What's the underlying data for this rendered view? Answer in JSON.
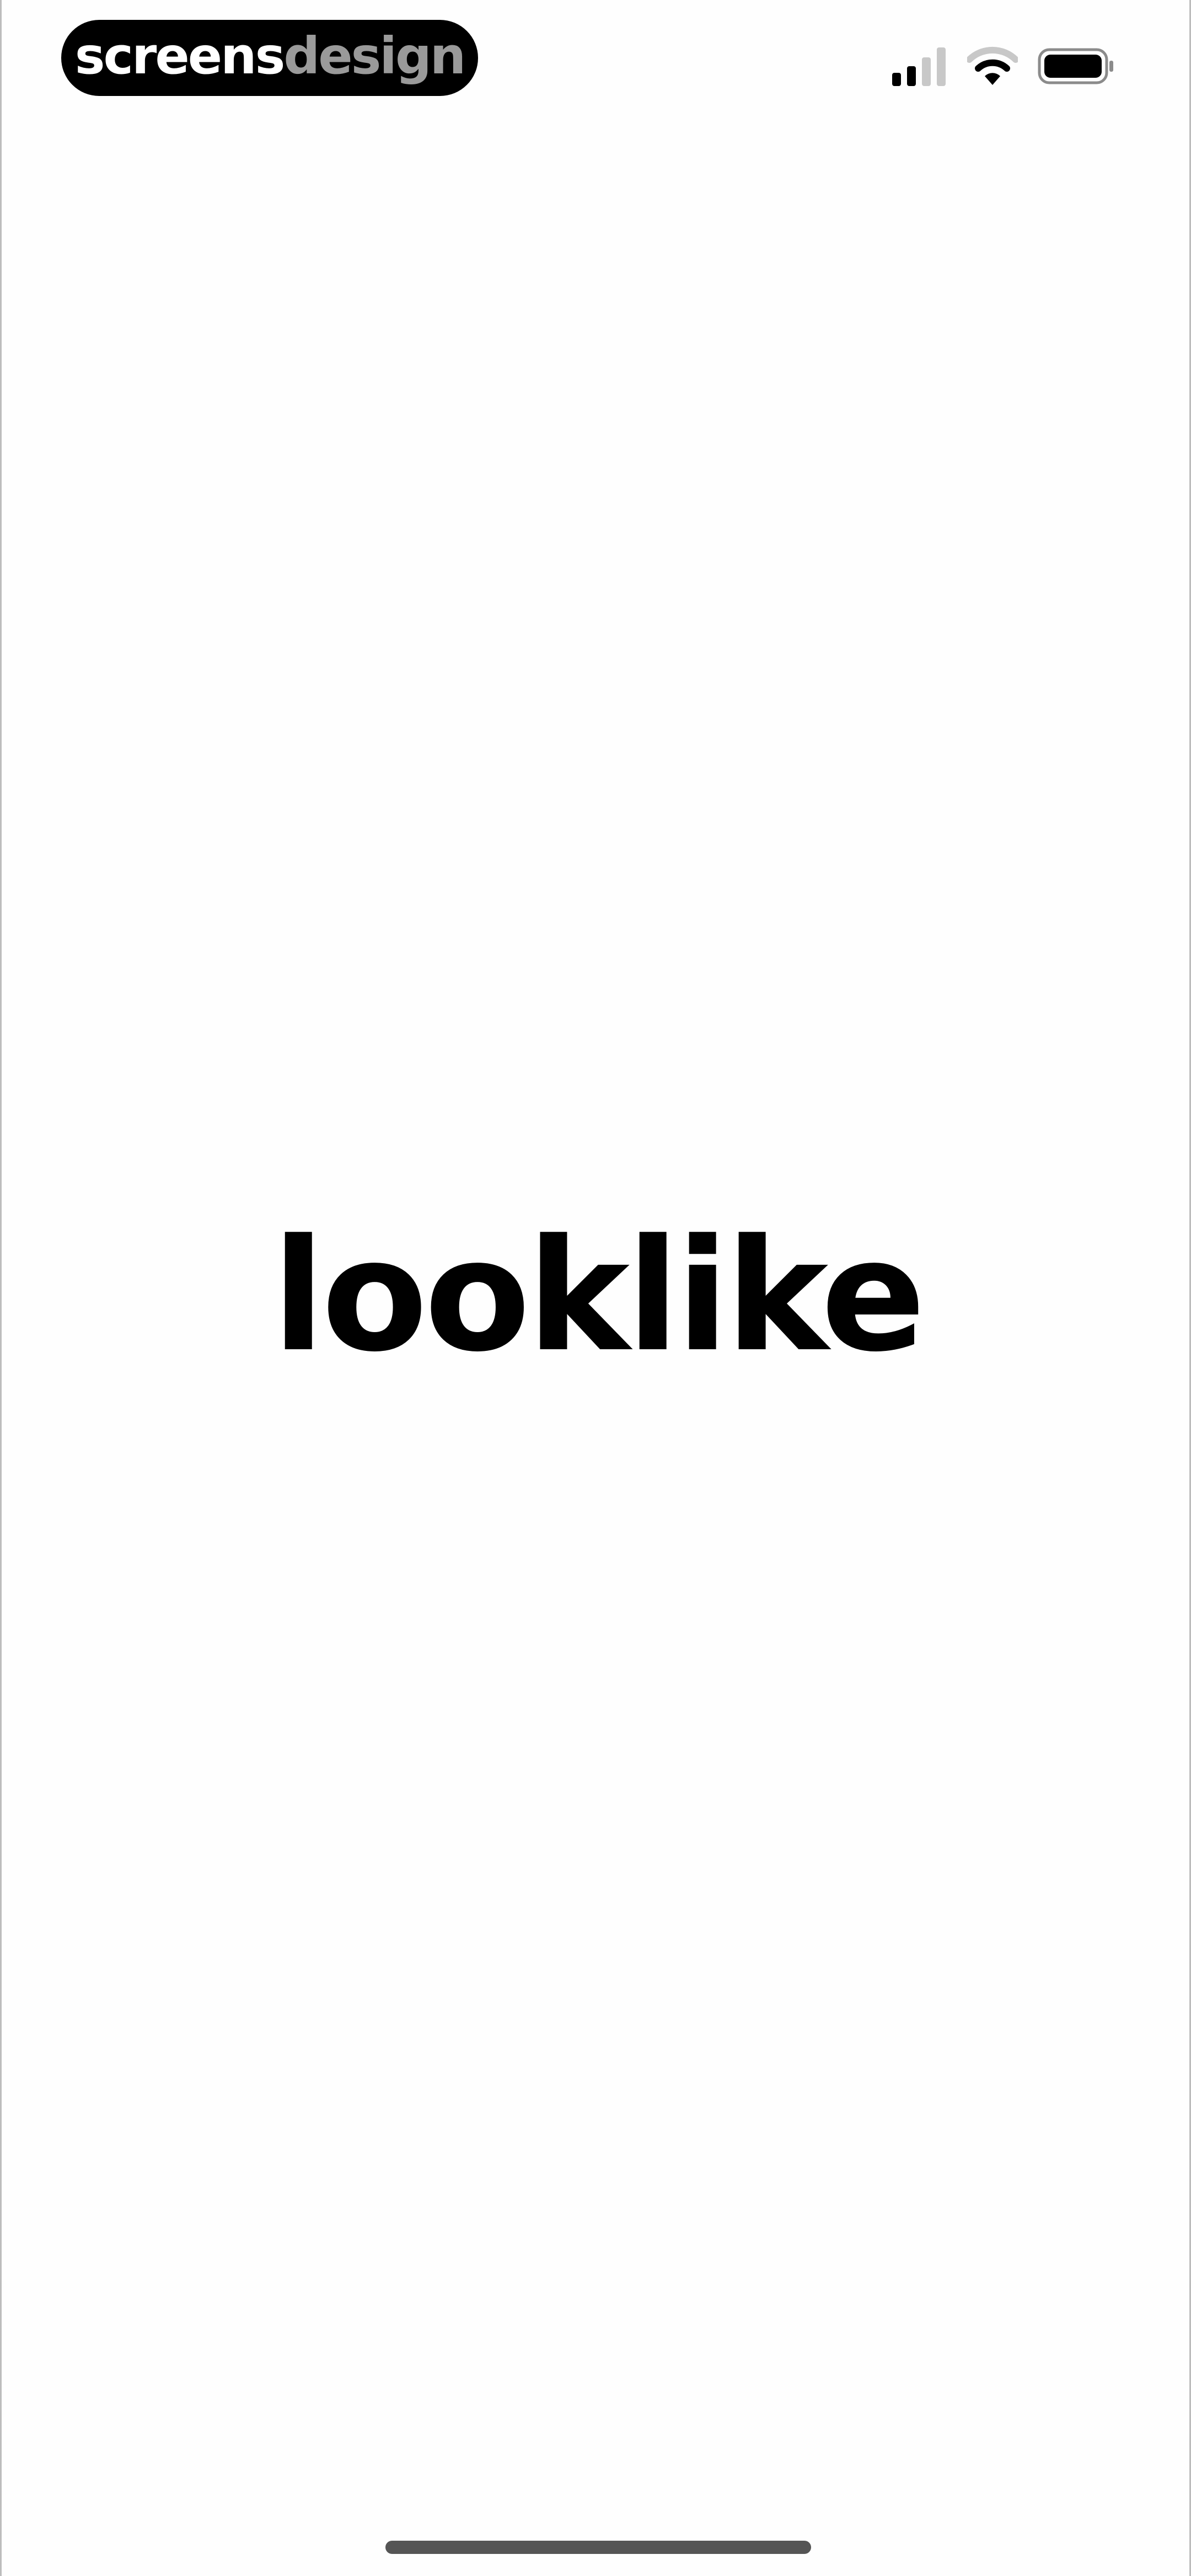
{
  "status_bar": {
    "brand_part1": "screens",
    "brand_part2": "design",
    "icons": [
      "cellular-signal-icon",
      "wifi-icon",
      "battery-icon"
    ]
  },
  "main": {
    "app_logo_text": "looklike"
  },
  "colors": {
    "background": "#fefefe",
    "text": "#000000",
    "brand_muted": "#9a9a9a",
    "home_indicator": "#555555"
  }
}
